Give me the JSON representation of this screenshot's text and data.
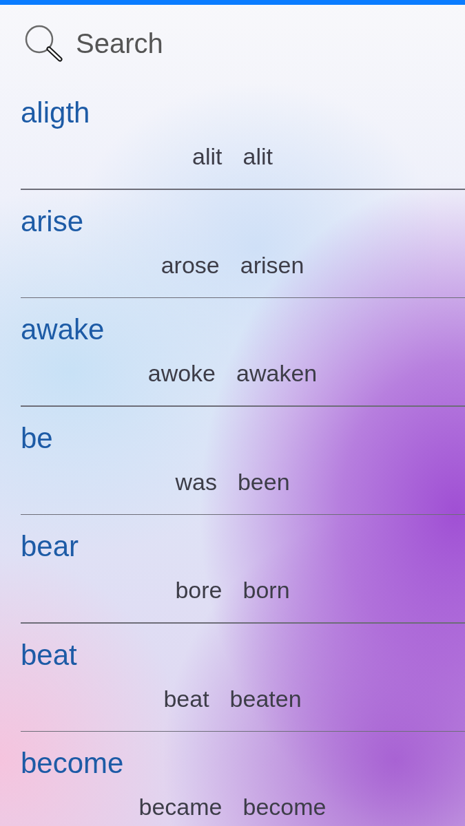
{
  "search": {
    "placeholder": "Search"
  },
  "verbs": [
    {
      "base": "aligth",
      "past": "alit",
      "participle": "alit"
    },
    {
      "base": "arise",
      "past": "arose",
      "participle": "arisen"
    },
    {
      "base": "awake",
      "past": "awoke",
      "participle": "awaken"
    },
    {
      "base": "be",
      "past": "was",
      "participle": "been"
    },
    {
      "base": "bear",
      "past": "bore",
      "participle": "born"
    },
    {
      "base": "beat",
      "past": "beat",
      "participle": "beaten"
    },
    {
      "base": "become",
      "past": "became",
      "participle": "become"
    }
  ]
}
